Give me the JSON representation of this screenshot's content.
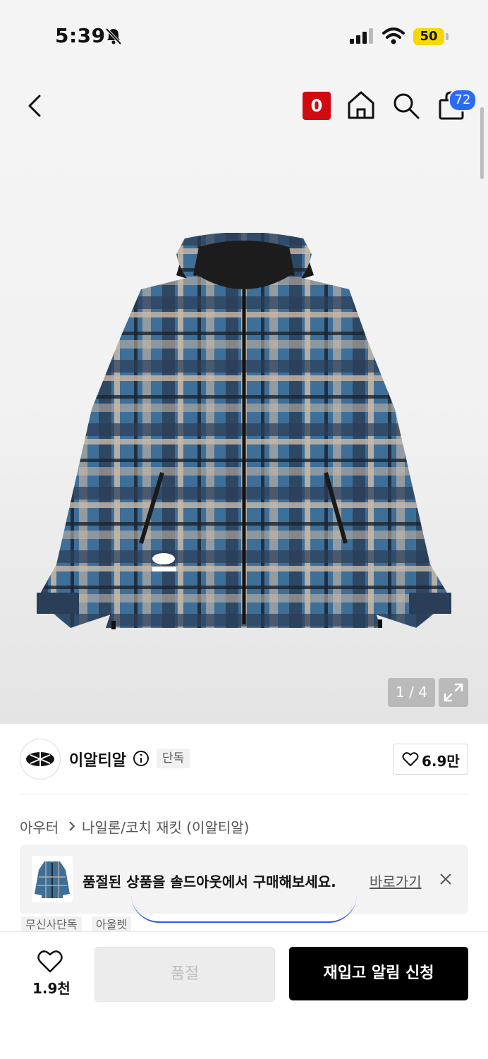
{
  "status_bar": {
    "time": "5:39",
    "battery": "50"
  },
  "header": {
    "brand_badge": "0",
    "cart_count": "72"
  },
  "gallery": {
    "pager": "1 / 4"
  },
  "brand": {
    "name": "이알티알",
    "badge": "단독",
    "likes": "6.9만"
  },
  "breadcrumb": {
    "level1": "아우터",
    "level2": "나일론/코치 재킷 (이알티알)"
  },
  "soldout_banner": {
    "message": "품절된 상품을 솔드아웃에서 구매해보세요.",
    "link": "바로가기"
  },
  "tags": [
    "무신사단독",
    "아울렛"
  ],
  "bottom": {
    "wish_count": "1.9천",
    "soldout_label": "품절",
    "restock_label": "재입고 알림 신청"
  },
  "colors": {
    "accent_red": "#d10a11",
    "badge_blue": "#2b6bf3",
    "battery_yellow": "#f5d800"
  },
  "icons": [
    "back-icon",
    "home-icon",
    "search-icon",
    "cart-icon",
    "expand-icon",
    "info-icon",
    "heart-icon",
    "close-icon",
    "chevron-right-icon"
  ]
}
